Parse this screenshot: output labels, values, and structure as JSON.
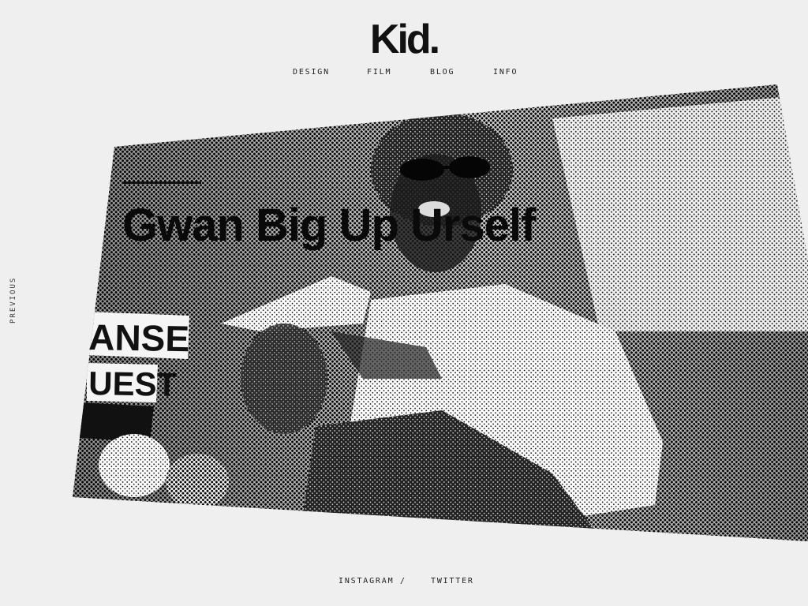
{
  "header": {
    "logo_text": "Kid."
  },
  "nav": {
    "items": [
      {
        "label": "DESIGN"
      },
      {
        "label": "FILM"
      },
      {
        "label": "BLOG"
      },
      {
        "label": "INFO"
      }
    ]
  },
  "side": {
    "previous_label": "PREVIOUS"
  },
  "hero": {
    "title": "Gwan Big Up Urself",
    "sign_text_top": "ANSE",
    "sign_text_bottom": "UEST"
  },
  "footer": {
    "links": [
      {
        "label": "INSTAGRAM"
      },
      {
        "label": "TWITTER"
      }
    ],
    "separator": "/"
  },
  "colors": {
    "background": "#efefef",
    "text": "#111111"
  }
}
